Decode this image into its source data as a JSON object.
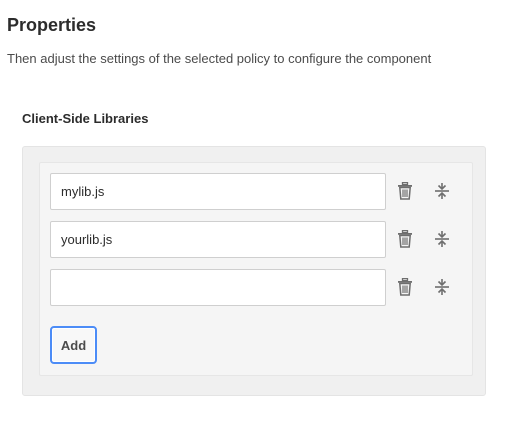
{
  "header": {
    "title": "Properties",
    "subtitle": "Then adjust the settings of the selected policy to configure the component"
  },
  "section": {
    "label": "Client-Side Libraries"
  },
  "libraries": [
    {
      "value": "mylib.js"
    },
    {
      "value": "yourlib.js"
    },
    {
      "value": ""
    }
  ],
  "actions": {
    "add_label": "Add",
    "delete_icon": "trash-icon",
    "reorder_icon": "move-vertical-icon"
  },
  "colors": {
    "accent": "#4c8cf7",
    "icon": "#6e6e6e"
  }
}
